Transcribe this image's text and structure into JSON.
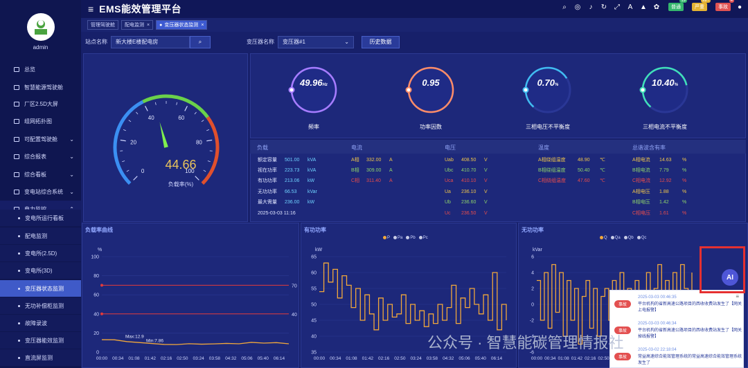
{
  "app": {
    "title": "EMS能效管理平台",
    "user": "admin"
  },
  "header": {
    "badges": [
      {
        "label": "普通",
        "count": "19",
        "color": "#35b66d"
      },
      {
        "label": "严重",
        "count": "99+",
        "color": "#e4b233"
      },
      {
        "label": "事故",
        "count": "4",
        "color": "#e05252"
      }
    ]
  },
  "sidebar": {
    "items": [
      {
        "label": "总览"
      },
      {
        "label": "智慧能源驾驶舱"
      },
      {
        "label": "厂区2.5D大屏"
      },
      {
        "label": "组网拓扑图"
      },
      {
        "label": "可配置驾驶舱",
        "arrow": "⌄"
      },
      {
        "label": "综合报表",
        "arrow": "⌄"
      },
      {
        "label": "综合看板",
        "arrow": "⌄"
      },
      {
        "label": "变电站综合系统",
        "arrow": "⌄"
      },
      {
        "label": "电力监控",
        "arrow": "⌃"
      }
    ],
    "subitems": [
      {
        "label": "变电所运行看板"
      },
      {
        "label": "配电监测"
      },
      {
        "label": "变电所(2.5D)"
      },
      {
        "label": "变电所(3D)"
      },
      {
        "label": "变压器状态监测"
      },
      {
        "label": "无功补偿柜监测"
      },
      {
        "label": "故障录波"
      },
      {
        "label": "变压器能效监测"
      },
      {
        "label": "直流屏监测"
      }
    ]
  },
  "tabs": [
    {
      "label": "管理驾驶舱"
    },
    {
      "label": "配电监测"
    },
    {
      "label": "变压器状态监测"
    }
  ],
  "filters": {
    "station_label": "站点名称",
    "station_value": "新大楼E楼配电房",
    "transformer_label": "变压器名称",
    "transformer_value": "变压器#1",
    "history_button": "历史数据"
  },
  "gauge": {
    "value": "44.66",
    "value_num": 44.66,
    "label": "负载率(%)",
    "ticks": [
      "0",
      "20",
      "40",
      "60",
      "80",
      "100"
    ]
  },
  "indicators": [
    {
      "value": "49.96",
      "unit": "Hz",
      "label": "频率",
      "fraction": 1.0,
      "color": "#a77cff"
    },
    {
      "value": "0.95",
      "unit": "",
      "label": "功率因数",
      "fraction": 0.95,
      "color": "#ff8c66"
    },
    {
      "value": "0.70",
      "unit": "%",
      "label": "三相电压不平衡度",
      "fraction": 0.007,
      "color": "#40bdf0"
    },
    {
      "value": "10.40",
      "unit": "%",
      "label": "三相电流不平衡度",
      "fraction": 0.104,
      "color": "#40e0b8"
    }
  ],
  "table": {
    "headers": [
      "负载",
      "电流",
      "电压",
      "温度",
      "总谐波含有率"
    ],
    "load": [
      {
        "name": "额定容量",
        "value": "501.00",
        "unit": "kVA"
      },
      {
        "name": "视在功率",
        "value": "223.73",
        "unit": "kVA"
      },
      {
        "name": "有功功率",
        "value": "213.06",
        "unit": "kW"
      },
      {
        "name": "无功功率",
        "value": "66.53",
        "unit": "kVar"
      },
      {
        "name": "最大需量",
        "value": "236.00",
        "unit": "kW"
      }
    ],
    "timestamp": "2025-03-03 11:16",
    "current": [
      {
        "name": "A相",
        "value": "332.00",
        "unit": "A",
        "color": "#f0c64a"
      },
      {
        "name": "B相",
        "value": "309.00",
        "unit": "A",
        "color": "#8ed36a"
      },
      {
        "name": "C相",
        "value": "311.40",
        "unit": "A",
        "color": "#e84c4c"
      }
    ],
    "voltage": [
      {
        "name": "Uab",
        "value": "408.50",
        "unit": "V",
        "color": "#f0c64a"
      },
      {
        "name": "Ubc",
        "value": "410.70",
        "unit": "V",
        "color": "#8ed36a"
      },
      {
        "name": "Uca",
        "value": "410.10",
        "unit": "V",
        "color": "#e84c4c"
      },
      {
        "name": "Ua",
        "value": "236.10",
        "unit": "V",
        "color": "#f0c64a"
      },
      {
        "name": "Ub",
        "value": "236.60",
        "unit": "V",
        "color": "#8ed36a"
      },
      {
        "name": "Uc",
        "value": "236.50",
        "unit": "V",
        "color": "#e84c4c"
      }
    ],
    "temperature": [
      {
        "name": "A相绕组温度",
        "value": "48.90",
        "unit": "℃",
        "color": "#f0c64a"
      },
      {
        "name": "B相绕组温度",
        "value": "50.40",
        "unit": "℃",
        "color": "#8ed36a"
      },
      {
        "name": "C相绕组温度",
        "value": "47.60",
        "unit": "℃",
        "color": "#e84c4c"
      }
    ],
    "harmonic": [
      {
        "name": "A相电流",
        "value": "14.63",
        "unit": "%",
        "color": "#f0c64a"
      },
      {
        "name": "B相电流",
        "value": "7.79",
        "unit": "%",
        "color": "#8ed36a"
      },
      {
        "name": "C相电流",
        "value": "12.92",
        "unit": "%",
        "color": "#e84c4c"
      },
      {
        "name": "A相电压",
        "value": "1.88",
        "unit": "%",
        "color": "#f0c64a"
      },
      {
        "name": "B相电压",
        "value": "1.42",
        "unit": "%",
        "color": "#8ed36a"
      },
      {
        "name": "C相电压",
        "value": "1.61",
        "unit": "%",
        "color": "#e84c4c"
      }
    ]
  },
  "chart_data": [
    {
      "type": "line",
      "title": "负载率曲线",
      "ylabel": "%",
      "ylim": [
        0,
        100
      ],
      "yticks": [
        "0",
        "20",
        "40",
        "60",
        "80",
        "100"
      ],
      "x": [
        "00:00",
        "00:34",
        "01:08",
        "01:42",
        "02:16",
        "02:50",
        "03:24",
        "03:58",
        "04:32",
        "05:06",
        "05:40",
        "06:14"
      ],
      "series": [
        {
          "values": [
            13,
            12.9,
            11,
            10,
            9,
            8,
            7.86,
            8.8,
            8.3,
            8.6,
            9.1,
            8.7,
            10.2,
            9.4,
            9.9,
            8.7
          ]
        }
      ],
      "annotations": {
        "max": "Max:12.9",
        "min": "Min:7.86",
        "upper": "70",
        "lower": "40"
      }
    },
    {
      "type": "line",
      "title": "有功功率",
      "ylabel": "kW",
      "ylim": [
        35,
        65
      ],
      "yticks": [
        "35",
        "40",
        "45",
        "50",
        "55",
        "60",
        "65"
      ],
      "x": [
        "00:00",
        "00:34",
        "01:08",
        "01:42",
        "02:16",
        "02:50",
        "03:24",
        "03:58",
        "04:32",
        "05:06",
        "05:40",
        "06:14"
      ],
      "legend": [
        "P",
        "Pa",
        "Pb",
        "Pc"
      ],
      "series": [
        {
          "name": "P",
          "values": [
            54,
            63,
            57,
            61,
            52,
            59,
            56,
            49,
            55,
            45,
            53,
            47,
            42,
            52,
            45,
            50,
            46,
            47,
            53,
            44,
            50,
            45,
            48,
            43,
            47,
            44,
            50,
            45,
            49,
            56,
            44,
            52,
            49,
            55,
            50,
            47,
            53,
            45,
            60,
            42,
            50,
            45
          ]
        }
      ]
    },
    {
      "type": "line",
      "title": "无功功率",
      "ylabel": "kVar",
      "ylim": [
        -6,
        6
      ],
      "yticks": [
        "-6",
        "-4",
        "-2",
        "0",
        "2",
        "4",
        "6"
      ],
      "x": [
        "00:00",
        "00:34",
        "01:08",
        "01:42",
        "02:16",
        "02:50",
        "03:24",
        "03:58",
        "04:32",
        "05:06",
        "05:40",
        "06:14"
      ],
      "legend": [
        "Q",
        "Qa",
        "Qb",
        "Qc"
      ],
      "series": [
        {
          "name": "Q",
          "values": [
            3,
            -2,
            4,
            -3,
            5,
            -1,
            4,
            -4,
            3,
            -2,
            2,
            -5,
            1,
            3,
            -3,
            2,
            -4,
            1,
            2,
            -2,
            3,
            -3,
            4,
            -1,
            2,
            -2,
            3,
            1,
            -2,
            4,
            -1,
            2,
            5,
            -2,
            3,
            0,
            4,
            1,
            5,
            2,
            -3,
            4
          ]
        }
      ]
    }
  ],
  "events": [
    {
      "tag": "事故",
      "time": "2025-03-03 00:46:35",
      "text": "平台机构的省新高速公路项目的西收收费站发生了【网关上电报警】"
    },
    {
      "tag": "事故",
      "time": "2025-03-03 00:46:34",
      "text": "平台机构的省新高速公路项目的西收收费站发生了【网关掉线报警】"
    },
    {
      "tag": "事故",
      "time": "2025-03-02 22:18:04",
      "text": "常益高速综合能效管理系统的常益高速综合能效管理系统发生了"
    }
  ],
  "watermark": "公众号 · 智慧能碳管理情报社",
  "ai_label": "AI"
}
